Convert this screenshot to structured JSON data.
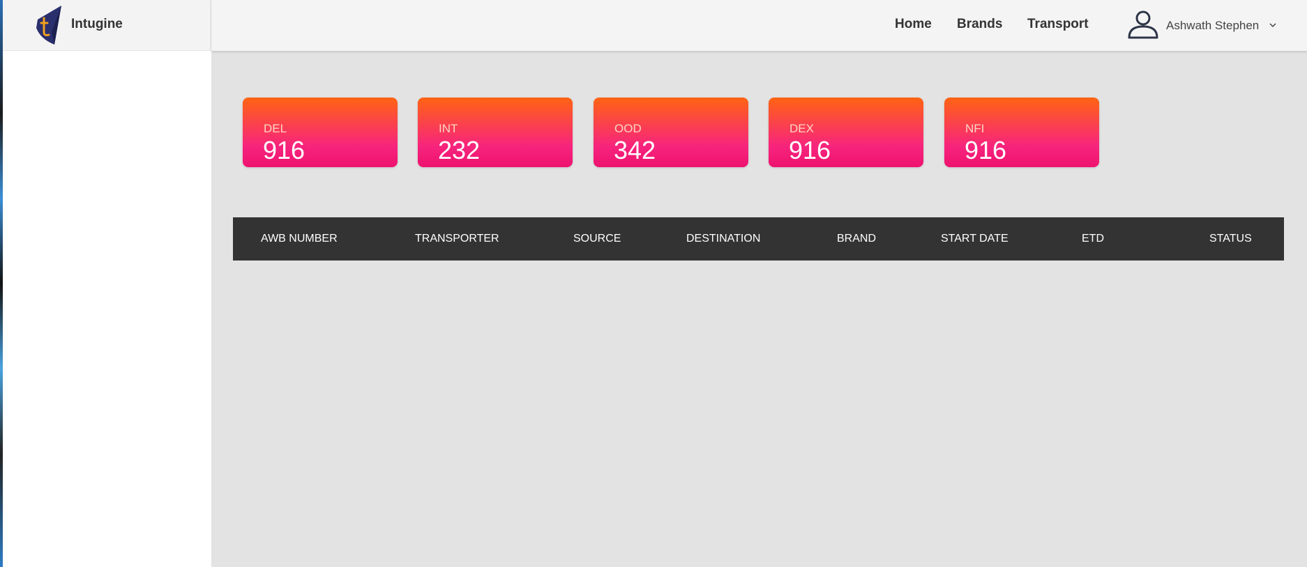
{
  "app": {
    "brand_name": "Intugine",
    "logo_icon": "intugine-logo-icon"
  },
  "nav": {
    "items": [
      {
        "label": "Home"
      },
      {
        "label": "Brands"
      },
      {
        "label": "Transport"
      }
    ],
    "user": {
      "name": "Ashwath Stephen",
      "icon": "user-avatar-icon",
      "dropdown_icon": "chevron-down-icon"
    }
  },
  "stats": [
    {
      "label": "DEL",
      "value": "916"
    },
    {
      "label": "INT",
      "value": "232"
    },
    {
      "label": "OOD",
      "value": "342"
    },
    {
      "label": "DEX",
      "value": "916"
    },
    {
      "label": "NFI",
      "value": "916"
    }
  ],
  "table": {
    "columns": [
      "AWB NUMBER",
      "TRANSPORTER",
      "SOURCE",
      "DESTINATION",
      "BRAND",
      "START DATE",
      "ETD",
      "STATUS"
    ],
    "rows": []
  },
  "colors": {
    "card_gradient_top": "#ff6412",
    "card_gradient_bottom": "#ee126f",
    "table_header_bg": "#333333",
    "page_bg": "#e3e3e3"
  }
}
